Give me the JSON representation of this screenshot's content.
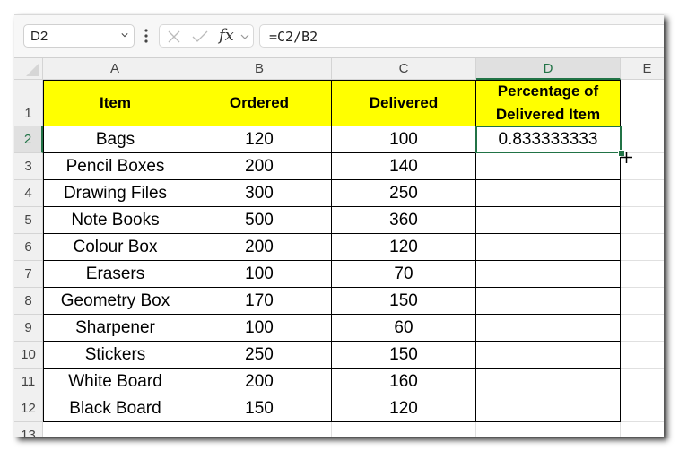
{
  "formula_bar": {
    "name_box": "D2",
    "formula": "=C2/B2",
    "fx_label": "fx"
  },
  "columns": [
    "A",
    "B",
    "C",
    "D",
    "E"
  ],
  "selected_column": "D",
  "rows": [
    "1",
    "2",
    "3",
    "4",
    "5",
    "6",
    "7",
    "8",
    "9",
    "10",
    "11",
    "12",
    "13"
  ],
  "selected_row": "2",
  "table": {
    "headers": [
      "Item",
      "Ordered",
      "Delivered",
      "Percentage of Delivered Item"
    ],
    "header_fill": "#ffff00",
    "data": [
      {
        "item": "Bags",
        "ordered": "120",
        "delivered": "100",
        "pct": "0.833333333"
      },
      {
        "item": "Pencil Boxes",
        "ordered": "200",
        "delivered": "140",
        "pct": ""
      },
      {
        "item": "Drawing Files",
        "ordered": "300",
        "delivered": "250",
        "pct": ""
      },
      {
        "item": "Note Books",
        "ordered": "500",
        "delivered": "360",
        "pct": ""
      },
      {
        "item": "Colour Box",
        "ordered": "200",
        "delivered": "120",
        "pct": ""
      },
      {
        "item": "Erasers",
        "ordered": "100",
        "delivered": "70",
        "pct": ""
      },
      {
        "item": "Geometry Box",
        "ordered": "170",
        "delivered": "150",
        "pct": ""
      },
      {
        "item": "Sharpener",
        "ordered": "100",
        "delivered": "60",
        "pct": ""
      },
      {
        "item": "Stickers",
        "ordered": "250",
        "delivered": "150",
        "pct": ""
      },
      {
        "item": "White Board",
        "ordered": "200",
        "delivered": "160",
        "pct": ""
      },
      {
        "item": "Black Board",
        "ordered": "150",
        "delivered": "120",
        "pct": ""
      }
    ]
  },
  "accent_color": "#217346"
}
